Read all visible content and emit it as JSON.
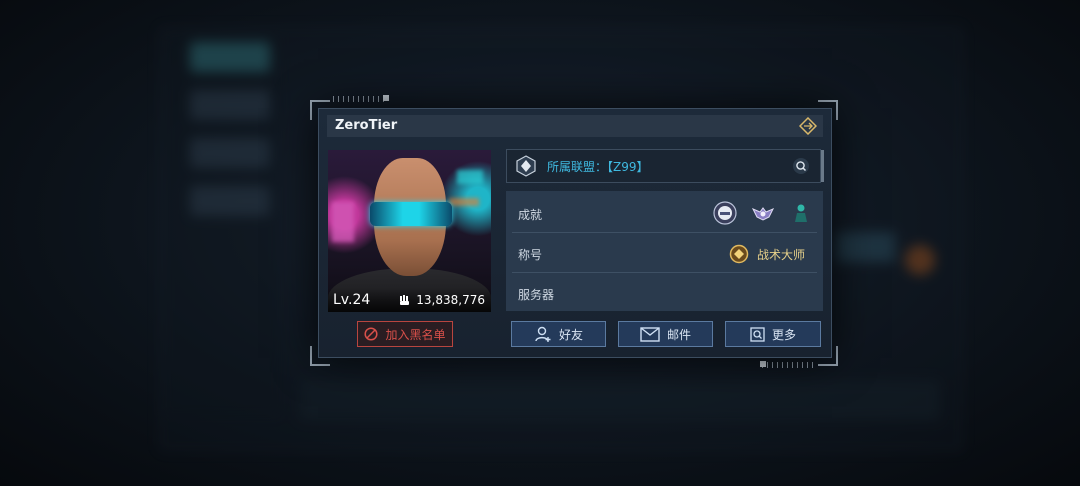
{
  "profile": {
    "name": "ZeroTier",
    "level": "Lv.24",
    "power": "13,838,776"
  },
  "alliance": {
    "label": "所属联盟：【Z99】"
  },
  "info": {
    "achievement_label": "成就",
    "achievement_badges": [
      "helmet-badge-icon",
      "wings-badge-icon",
      "figure-badge-icon"
    ],
    "title_label": "称号",
    "title_value": "战术大师",
    "server_label": "服务器",
    "server_value": ""
  },
  "actions": {
    "blacklist": "加入黑名单",
    "friend": "好友",
    "mail": "邮件",
    "more": "更多"
  },
  "colors": {
    "accent_cyan": "#3fb9e0",
    "danger_red": "#d8504a",
    "title_gold": "#e6d08a",
    "button_blue": "#243a5a"
  }
}
